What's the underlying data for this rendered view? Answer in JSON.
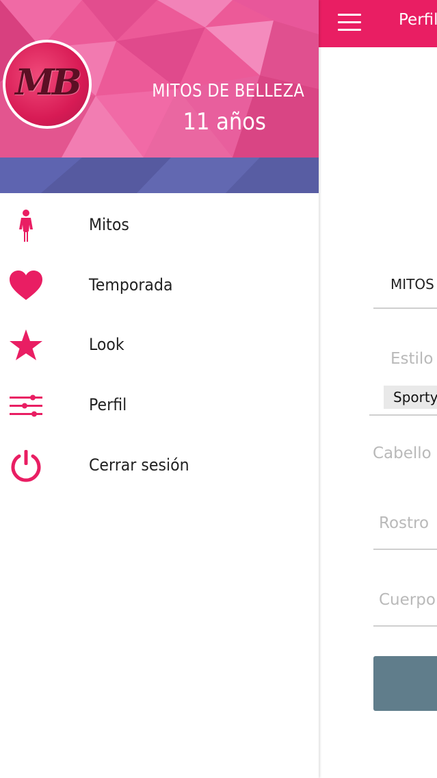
{
  "theme": {
    "accent": "#e91e63",
    "button_color": "#607d8b",
    "header_band": "#5b5fa8"
  },
  "background_screen": {
    "header_title": "Perfil",
    "menu_icon": "hamburger-menu-icon",
    "mitos_label": "MITOS",
    "estilo_label": "Estilo",
    "estilo_value": "Sporty",
    "cabello_label": "Cabello",
    "rostro_label": "Rostro",
    "cuerpo_label": "Cuerpo"
  },
  "drawer": {
    "logo_text": "MB",
    "brand_name": "MITOS DE BELLEZA",
    "brand_years": "11 años",
    "items": [
      {
        "label": "Mitos",
        "icon": "woman-icon"
      },
      {
        "label": "Temporada",
        "icon": "heart-icon"
      },
      {
        "label": "Look",
        "icon": "star-icon"
      },
      {
        "label": "Perfil",
        "icon": "sliders-icon"
      },
      {
        "label": "Cerrar sesión",
        "icon": "power-icon"
      }
    ]
  }
}
